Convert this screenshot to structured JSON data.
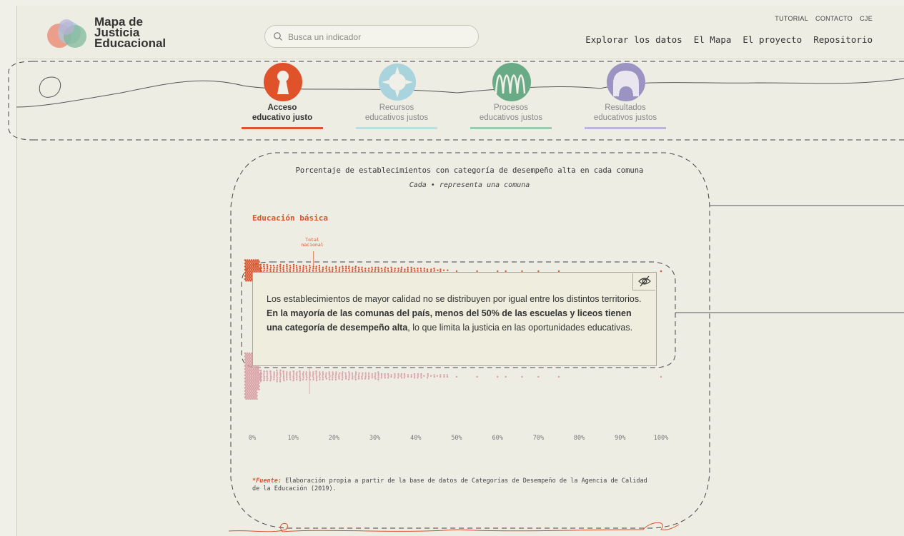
{
  "header": {
    "logo_text": [
      "Mapa de",
      "Justicia",
      "Educacional"
    ],
    "search_placeholder": "Busca un indicador",
    "top_links": [
      "TUTORIAL",
      "CONTACTO",
      "CJE"
    ],
    "main_nav": [
      "Explorar los datos",
      "El Mapa",
      "El proyecto",
      "Repositorio"
    ]
  },
  "categories": [
    {
      "line1": "Acceso",
      "line2": "educativo justo",
      "color": "#e0522a",
      "bar_color": "#e0522a",
      "active": true,
      "icon": "keyhole-icon"
    },
    {
      "line1": "Recursos",
      "line2": "educativos justos",
      "color": "#a9d3dd",
      "bar_color": "#bcdde3",
      "active": false,
      "icon": "gear-blob-icon"
    },
    {
      "line1": "Procesos",
      "line2": "educativos justos",
      "color": "#6aab87",
      "bar_color": "#9ccab0",
      "active": false,
      "icon": "wave-icon"
    },
    {
      "line1": "Resultados",
      "line2": "educativos justos",
      "color": "#9b93c2",
      "bar_color": "#bcb6d6",
      "active": false,
      "icon": "arch-icon"
    }
  ],
  "chart": {
    "title": "Porcentaje de establecimientos con categoría de desempeño alta en cada comuna",
    "subtitle": "Cada • representa una comuna",
    "section": "Educación básica",
    "total_label": [
      "Total",
      "nacional"
    ],
    "source_prefix": "*Fuente:",
    "source_text": " Elaboración propia a partir de la base de datos de Categorías de Desempeño de la Agencia de Calidad de la Educación (2019)."
  },
  "tooltip": {
    "part1": "Los establecimientos de mayor calidad no se distribuyen por igual entre los distintos territorios. ",
    "bold": "En la mayoría de las comunas del país, menos del 50% de las escuelas y liceos tienen una categoría de desempeño alta",
    "part2": ", lo que limita la justicia en las oportunidades educativas."
  },
  "chart_data": {
    "type": "scatter",
    "title": "Porcentaje de establecimientos con categoría de desempeño alta en cada comuna",
    "x_ticks": [
      "0%",
      "10%",
      "20%",
      "30%",
      "40%",
      "50%",
      "60%",
      "70%",
      "80%",
      "90%",
      "100%"
    ],
    "xlim": [
      0,
      100
    ],
    "series": [
      {
        "name": "Educación básica",
        "color": "#d9532c",
        "total_nacional": 15
      },
      {
        "color": "#d9a0a5",
        "total_nacional": 14
      }
    ]
  }
}
